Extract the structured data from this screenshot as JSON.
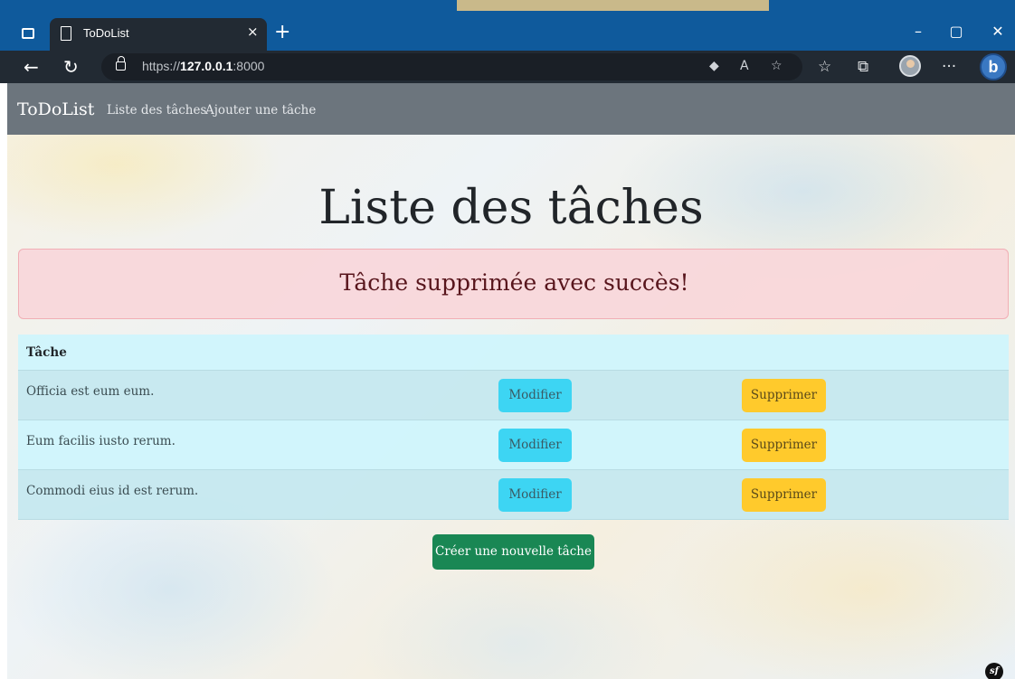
{
  "browser": {
    "tab_title": "ToDoList",
    "tab_close": "×",
    "new_tab": "+",
    "url_scheme": "https://",
    "url_host": "127.0.0.1",
    "url_port": ":8000",
    "minimize": "–",
    "maximize": "▢",
    "close": "✕",
    "back": "←",
    "refresh": "↻",
    "more": "···",
    "bing": "b"
  },
  "navbar": {
    "brand": "ToDoList",
    "links": [
      {
        "label": "Liste des tâches"
      },
      {
        "label": "Ajouter une tâche"
      }
    ]
  },
  "main": {
    "title": "Liste des tâches",
    "alert": "Tâche supprimée avec succès!",
    "table": {
      "header": "Tâche",
      "rows": [
        {
          "task": "Officia est eum eum.",
          "edit_label": "Modifier",
          "delete_label": "Supprimer"
        },
        {
          "task": "Eum facilis iusto rerum.",
          "edit_label": "Modifier",
          "delete_label": "Supprimer"
        },
        {
          "task": "Commodi eius id est rerum.",
          "edit_label": "Modifier",
          "delete_label": "Supprimer"
        }
      ]
    },
    "create_button": "Créer une nouvelle tâche"
  },
  "debug": {
    "symfony_badge": "sf"
  },
  "colors": {
    "navbar": "#6c757d",
    "alert_bg": "#f8d7da",
    "table_bg": "#cff4fc",
    "btn_info": "#3dd5f3",
    "btn_warning": "#ffca2c",
    "btn_success": "#198754"
  }
}
